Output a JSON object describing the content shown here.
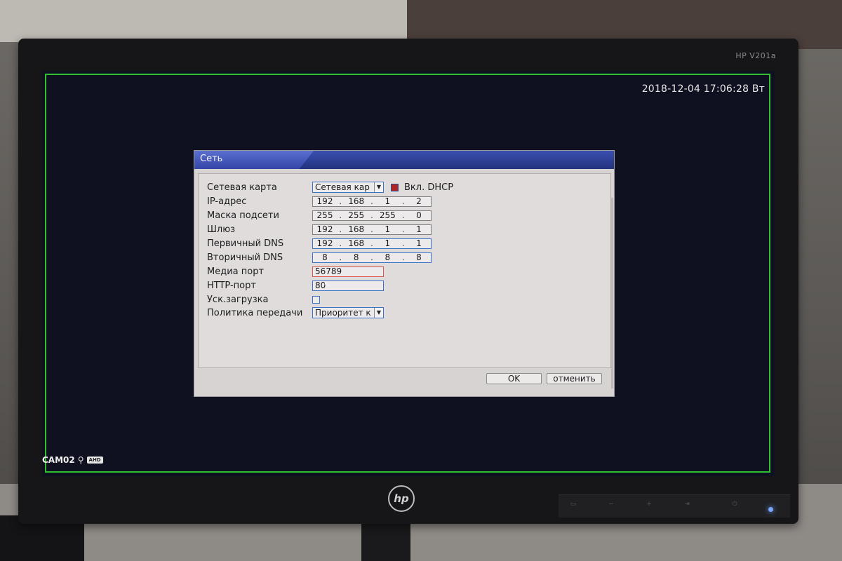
{
  "monitor": {
    "model": "HP V201a",
    "brand_logo": "hp"
  },
  "screen": {
    "timestamp": "2018-12-04 17:06:28 Вт",
    "camera": {
      "name": "CAM02",
      "badge": "AHD",
      "icon": "network-icon"
    }
  },
  "dialog": {
    "title": "Сеть",
    "rows": [
      {
        "label": "Сетевая карта",
        "value": "Сетевая кар"
      },
      {
        "label": "IP-адрес",
        "octets": [
          "192",
          "168",
          "1",
          "2"
        ]
      },
      {
        "label": "Маска подсети",
        "octets": [
          "255",
          "255",
          "255",
          "0"
        ]
      },
      {
        "label": "Шлюз",
        "octets": [
          "192",
          "168",
          "1",
          "1"
        ]
      },
      {
        "label": "Первичный DNS",
        "octets": [
          "192",
          "168",
          "1",
          "1"
        ]
      },
      {
        "label": "Вторичный DNS",
        "octets": [
          "8",
          "8",
          "8",
          "8"
        ]
      },
      {
        "label": "Медиа порт",
        "value": "56789"
      },
      {
        "label": "HTTP-порт",
        "value": "80"
      },
      {
        "label": "Уск.загрузка",
        "checked": false
      },
      {
        "label": "Политика передачи",
        "value": "Приоритет к"
      }
    ],
    "dhcp": {
      "label": "Вкл. DHCP",
      "checked": true
    },
    "buttons": {
      "ok": "OK",
      "cancel": "отменить"
    }
  },
  "colors": {
    "title_bar": "#23327e",
    "focus_border": "#3a72c7",
    "active_border": "#d9574f",
    "overlay_frame": "#2fc12f"
  }
}
